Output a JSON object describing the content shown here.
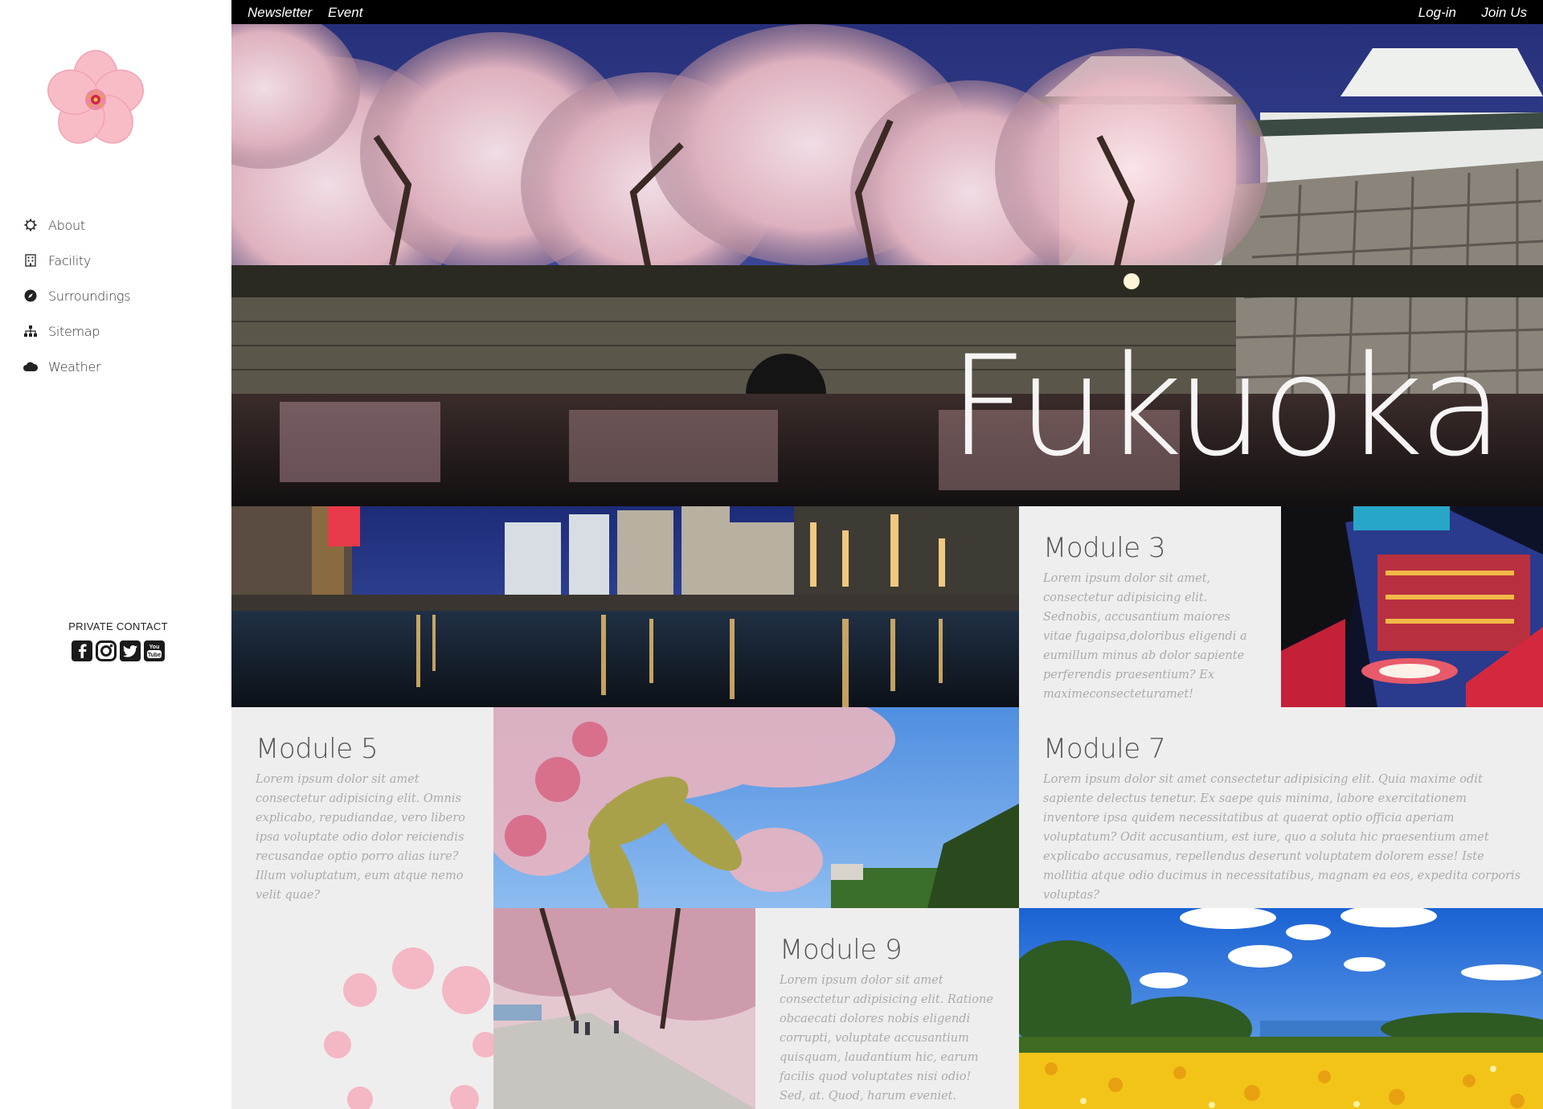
{
  "topbar": {
    "newsletter": "Newsletter",
    "event": "Event",
    "login": "Log-in",
    "join": "Join Us"
  },
  "sidebar": {
    "items": [
      {
        "label": "About",
        "icon": "gear-icon"
      },
      {
        "label": "Facility",
        "icon": "building-icon"
      },
      {
        "label": "Surroundings",
        "icon": "compass-icon"
      },
      {
        "label": "Sitemap",
        "icon": "sitemap-icon"
      },
      {
        "label": "Weather",
        "icon": "cloud-icon"
      }
    ],
    "contact_title": "PRIVATE CONTACT",
    "socials": [
      "facebook-icon",
      "instagram-icon",
      "twitter-icon",
      "youtube-icon"
    ]
  },
  "hero": {
    "title": "Fukuoka"
  },
  "modules": {
    "m3": {
      "title": "Module 3",
      "body": "Lorem ipsum dolor sit amet, consectetur adipisicing elit. Sednobis, accusantium maiores vitae fugaipsa,doloribus eligendi a eumillum minus ab dolor sapiente perferendis praesentium? Ex maximeconsecteturamet!"
    },
    "m5": {
      "title": "Module 5",
      "body": "Lorem ipsum dolor sit amet consectetur adipisicing elit. Omnis explicabo, repudiandae, vero libero ipsa voluptate odio dolor reiciendis recusandae optio porro alias iure? Illum voluptatum, eum atque nemo velit quae?"
    },
    "m7": {
      "title": "Module 7",
      "body": "Lorem ipsum dolor sit amet consectetur adipisicing elit. Quia maxime odit sapiente delectus tenetur. Ex saepe quis minima, labore exercitationem inventore ipsa quidem necessitatibus at quaerat optio officia aperiam voluptatum? Odit accusantium, est iure, quo a soluta hic praesentium amet explicabo accusamus, repellendus deserunt voluptatem dolorem esse! Iste mollitia atque odio ducimus in necessitatibus, magnam ea eos, expedita corporis voluptas?"
    },
    "m9": {
      "title": "Module 9",
      "body": "Lorem ipsum dolor sit amet consectetur adipisicing elit. Ratione obcaecati dolores nobis eligendi corrupti, voluptate accusantium quisquam, laudantium hic, earum facilis quod voluptates nisi odio! Sed, at. Quod, harum eveniet."
    }
  },
  "colors": {
    "blossom_pink": "#f6b6c2",
    "topbar_bg": "#000000",
    "module_bg": "#efeeee"
  }
}
